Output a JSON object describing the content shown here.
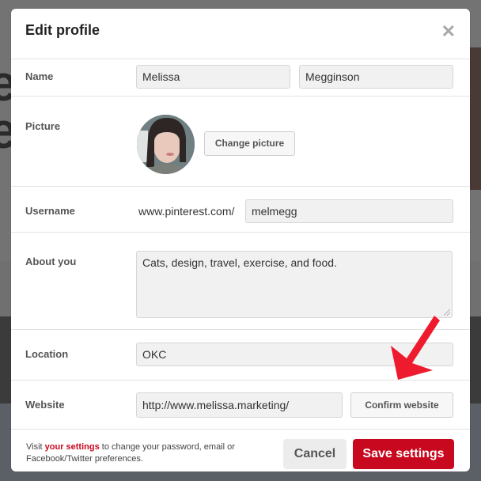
{
  "modal": {
    "title": "Edit profile",
    "close_icon": "close-icon"
  },
  "fields": {
    "name": {
      "label": "Name",
      "first_name": "Melissa",
      "last_name": "Megginson"
    },
    "picture": {
      "label": "Picture",
      "change_button": "Change picture"
    },
    "username": {
      "label": "Username",
      "prefix": "www.pinterest.com/",
      "value": "melmegg"
    },
    "about": {
      "label": "About you",
      "value": "Cats, design, travel, exercise, and food."
    },
    "location": {
      "label": "Location",
      "value": "OKC"
    },
    "website": {
      "label": "Website",
      "value": "http://www.melissa.marketing/",
      "confirm_button": "Confirm website"
    }
  },
  "footer": {
    "note_prefix": "Visit ",
    "note_link": "your settings",
    "note_suffix": " to change your password, email or Facebook/Twitter preferences.",
    "cancel_label": "Cancel",
    "save_label": "Save settings"
  },
  "colors": {
    "accent": "#c8081e",
    "annotation_arrow": "#ee1b2e"
  }
}
